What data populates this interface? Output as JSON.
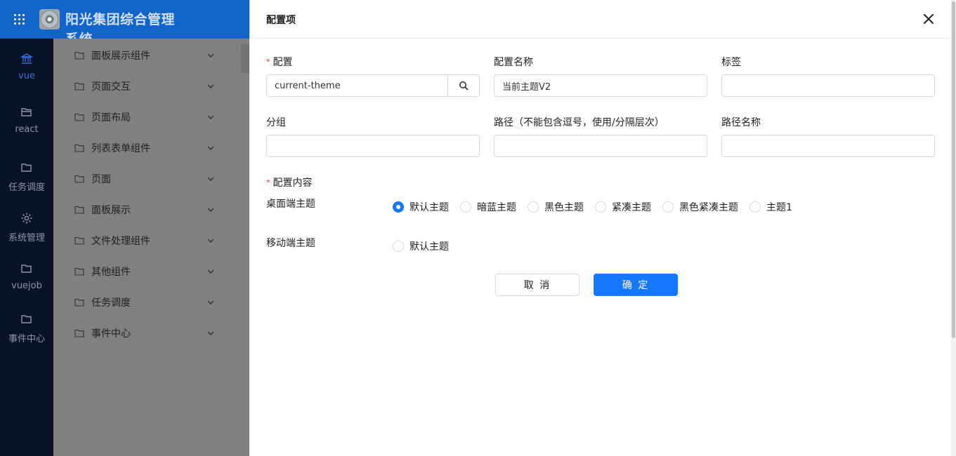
{
  "app": {
    "title": "阳光集团综合管理系统"
  },
  "leftnav": [
    {
      "label": "vue",
      "icon": "bank-icon",
      "active": true
    },
    {
      "label": "react",
      "icon": "folder-open-icon"
    },
    {
      "label": "任务调度",
      "icon": "folder-icon"
    },
    {
      "label": "系统管理",
      "icon": "gear-icon"
    },
    {
      "label": "vuejob",
      "icon": "folder-icon"
    },
    {
      "label": "事件中心",
      "icon": "folder-icon"
    }
  ],
  "subnav": [
    {
      "label": "面板展示组件"
    },
    {
      "label": "页面交互"
    },
    {
      "label": "页面布局"
    },
    {
      "label": "列表表单组件"
    },
    {
      "label": "页面"
    },
    {
      "label": "面板展示"
    },
    {
      "label": "文件处理组件"
    },
    {
      "label": "其他组件"
    },
    {
      "label": "任务调度"
    },
    {
      "label": "事件中心"
    }
  ],
  "drawer": {
    "title": "配置项",
    "required_mark": "*",
    "fields": {
      "config": {
        "label": "配置",
        "value": "current-theme"
      },
      "config_name": {
        "label": "配置名称",
        "value": "当前主题V2"
      },
      "tags": {
        "label": "标签",
        "value": ""
      },
      "group": {
        "label": "分组",
        "value": ""
      },
      "path": {
        "label": "路径（不能包含逗号，使用/分隔层次）",
        "value": ""
      },
      "path_name": {
        "label": "路径名称",
        "value": ""
      }
    },
    "content": {
      "label": "配置内容",
      "desktop": {
        "label": "桌面端主题",
        "options": [
          "默认主题",
          "暗蓝主题",
          "黑色主题",
          "紧凑主题",
          "黑色紧凑主题",
          "主题1"
        ],
        "selected": "默认主题"
      },
      "mobile": {
        "label": "移动端主题",
        "options": [
          "默认主题"
        ],
        "selected": ""
      }
    },
    "buttons": {
      "cancel": "取 消",
      "ok": "确 定"
    }
  },
  "colors": {
    "primary": "#1677ff",
    "topbar": "#1364c9",
    "leftnav": "#0a1226",
    "required": "#ff4d4f"
  }
}
